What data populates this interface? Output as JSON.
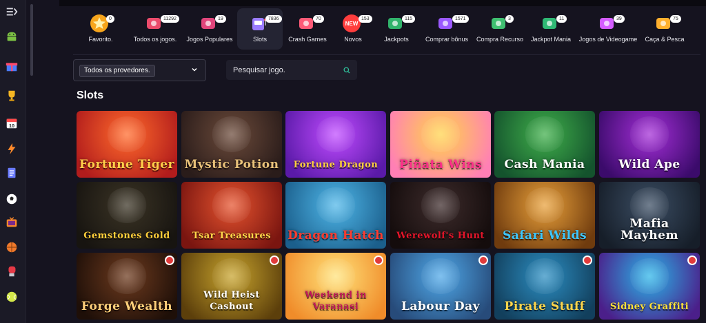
{
  "rail": {
    "items": [
      {
        "name": "menu-toggle-icon",
        "glyph": "menu"
      },
      {
        "name": "android-icon",
        "glyph": "android"
      },
      {
        "name": "gift-icon",
        "glyph": "gift"
      },
      {
        "name": "trophy-icon",
        "glyph": "trophy"
      },
      {
        "name": "calendar-icon",
        "glyph": "calendar",
        "text": "10"
      },
      {
        "name": "lightning-icon",
        "glyph": "bolt"
      },
      {
        "name": "ticket-icon",
        "glyph": "ticket"
      },
      {
        "name": "football-icon",
        "glyph": "soccer"
      },
      {
        "name": "tv-icon",
        "glyph": "tv"
      },
      {
        "name": "basketball-icon",
        "glyph": "basketball"
      },
      {
        "name": "boxing-glove-icon",
        "glyph": "boxing"
      },
      {
        "name": "tennis-ball-icon",
        "glyph": "tennis"
      }
    ]
  },
  "categories": [
    {
      "label": "Favorito.",
      "count": "0",
      "icon": "star-icon",
      "color": "#f5a623"
    },
    {
      "label": "Todos os jogos.",
      "count": "11292",
      "icon": "all-games-icon",
      "color": "#ec4b6b"
    },
    {
      "label": "Jogos Populares",
      "count": "19",
      "icon": "popular-badge-icon",
      "color": "#e0457b"
    },
    {
      "label": "Slots",
      "count": "7836",
      "icon": "slot-machine-icon",
      "color": "#8a6cf0",
      "active": true
    },
    {
      "label": "Crash Games",
      "count": "70",
      "icon": "crash-games-icon",
      "color": "#ff5a77"
    },
    {
      "label": "Novos",
      "count": "153",
      "icon": "new-icon",
      "color": "#ff3d3d"
    },
    {
      "label": "Jackpots",
      "count": "115",
      "icon": "jackpot-icon",
      "color": "#31b36b"
    },
    {
      "label": "Comprar bônus",
      "count": "1571",
      "icon": "buy-bonus-icon",
      "color": "#9b59ff"
    },
    {
      "label": "Compra Recurso",
      "count": "3",
      "icon": "buy-feature-icon",
      "color": "#3fbf70"
    },
    {
      "label": "Jackpot Mania",
      "count": "11",
      "icon": "jackpot-mania-icon",
      "color": "#2fb874"
    },
    {
      "label": "Jogos de Videogame",
      "count": "39",
      "icon": "video-game-icon",
      "color": "#d45cff"
    },
    {
      "label": "Caça & Pesca",
      "count": "75",
      "icon": "fishing-icon",
      "color": "#ffb02e"
    }
  ],
  "filters": {
    "provider_value": "Todos os provedores.",
    "search_placeholder": "Pesquisar jogo."
  },
  "section_title": "Slots",
  "games": [
    {
      "title": "Fortune Tiger",
      "bg": [
        "#ff6a2b",
        "#b11c1c"
      ],
      "text": "#ffcf4a"
    },
    {
      "title": "Mystic Potion",
      "bg": [
        "#6b4a3a",
        "#2a1c1a"
      ],
      "text": "#e9c27a"
    },
    {
      "title": "Fortune Dragon",
      "bg": [
        "#c04bff",
        "#5a1aa8"
      ],
      "text": "#ffd23d"
    },
    {
      "title": "Piñata Wins",
      "bg": [
        "#ffd34a",
        "#ff7fb5"
      ],
      "text": "#ff2f8a"
    },
    {
      "title": "Cash Mania",
      "bg": [
        "#3fae4a",
        "#14532d"
      ],
      "text": "#ffffff"
    },
    {
      "title": "Wild Ape",
      "bg": [
        "#a32ed6",
        "#3b0b6b"
      ],
      "text": "#ffffff"
    },
    {
      "title": "Gemstones Gold",
      "bg": [
        "#3b3425",
        "#171410"
      ],
      "text": "#ffcf3a"
    },
    {
      "title": "Tsar Treasures",
      "bg": [
        "#e5532e",
        "#7a1510"
      ],
      "text": "#ffd84a"
    },
    {
      "title": "Dragon Hatch",
      "bg": [
        "#4fb6e8",
        "#1b5f8c"
      ],
      "text": "#ff3c2f"
    },
    {
      "title": "Werewolf's Hunt",
      "bg": [
        "#3d2b2b",
        "#140c0c"
      ],
      "text": "#e5152a"
    },
    {
      "title": "Safari Wilds",
      "bg": [
        "#e8a03a",
        "#6f3b0e"
      ],
      "text": "#3cc6ff"
    },
    {
      "title": "Mafia Mayhem",
      "bg": [
        "#3b4d63",
        "#161e29"
      ],
      "text": "#ffffff"
    },
    {
      "title": "Forge Wealth",
      "bg": [
        "#6d3a1e",
        "#1e0f08"
      ],
      "text": "#ffcf7a"
    },
    {
      "title": "Wild Heist Cashout",
      "bg": [
        "#c7a32d",
        "#5c3f0b"
      ],
      "text": "#ffffff"
    },
    {
      "title": "Weekend in Varanasi",
      "bg": [
        "#ffe27a",
        "#f08c2a"
      ],
      "text": "#c2185b"
    },
    {
      "title": "Labour Day",
      "bg": [
        "#4fa8e8",
        "#274b7a"
      ],
      "text": "#ffffff"
    },
    {
      "title": "Pirate Stuff",
      "bg": [
        "#2c8ec2",
        "#123f5c"
      ],
      "text": "#ffd54a"
    },
    {
      "title": "Sidney Graffiti",
      "bg": [
        "#2bb5e8",
        "#4b1f8a"
      ],
      "text": "#ffe23a"
    }
  ]
}
